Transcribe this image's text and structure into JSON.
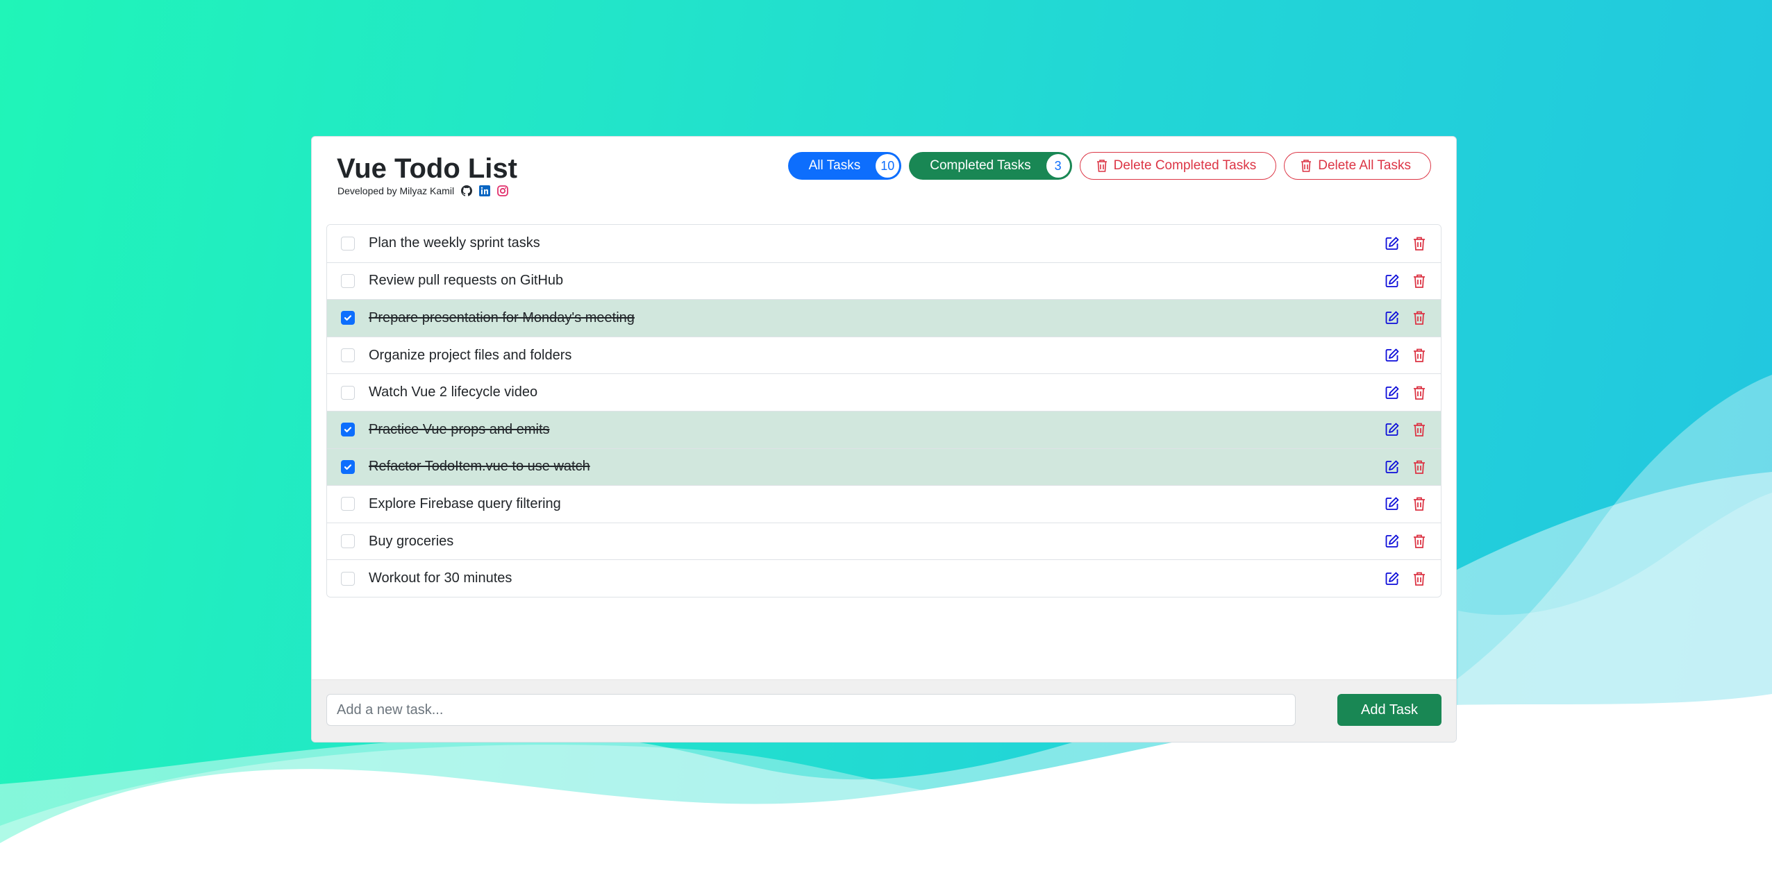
{
  "app": {
    "title": "Vue Todo List",
    "subtitle": "Developed by Milyaz Kamil",
    "social_icons": [
      "github-icon",
      "linkedin-icon",
      "instagram-icon"
    ]
  },
  "toolbar": {
    "all_tasks_label": "All Tasks",
    "all_tasks_count": "10",
    "completed_tasks_label": "Completed Tasks",
    "completed_tasks_count": "3",
    "delete_completed_label": "Delete Completed Tasks",
    "delete_all_label": "Delete All Tasks"
  },
  "tasks": [
    {
      "text": "Plan the weekly sprint tasks",
      "completed": false
    },
    {
      "text": "Review pull requests on GitHub",
      "completed": false
    },
    {
      "text": "Prepare presentation for Monday's meeting",
      "completed": true
    },
    {
      "text": "Organize project files and folders",
      "completed": false
    },
    {
      "text": "Watch Vue 2 lifecycle video",
      "completed": false
    },
    {
      "text": "Practice Vue props and emits",
      "completed": true
    },
    {
      "text": "Refactor TodoItem.vue to use watch",
      "completed": true
    },
    {
      "text": "Explore Firebase query filtering",
      "completed": false
    },
    {
      "text": "Buy groceries",
      "completed": false
    },
    {
      "text": "Workout for 30 minutes",
      "completed": false
    }
  ],
  "footer": {
    "input_placeholder": "Add a new task...",
    "input_value": "",
    "add_button_label": "Add Task"
  },
  "colors": {
    "primary": "#0d6efd",
    "success": "#198754",
    "danger": "#dc3545",
    "completed_row": "#d1e7dd",
    "edit_icon": "#0d0dd9"
  }
}
